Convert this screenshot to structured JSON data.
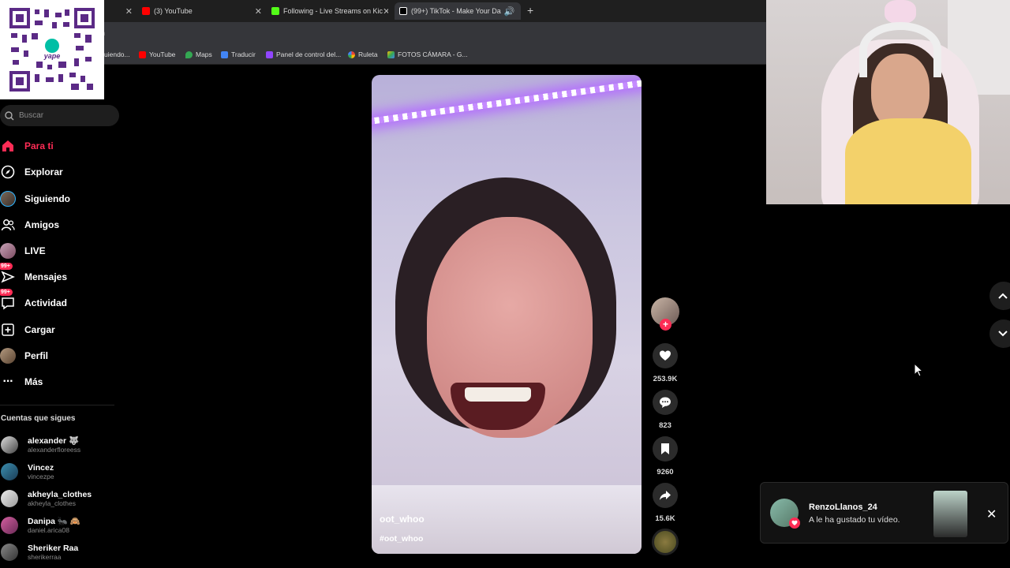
{
  "browser": {
    "tabs": [
      {
        "label": "",
        "icon": "blank-tab-icon"
      },
      {
        "label": "(3) YouTube",
        "icon": "youtube-icon",
        "color": "#ff0000"
      },
      {
        "label": "Following - Live Streams on Kic",
        "icon": "kick-icon",
        "color": "#53fc18"
      },
      {
        "label": "(99+) TikTok - Make Your Da",
        "icon": "tiktok-icon",
        "color": "#ffffff"
      }
    ],
    "address_fragment": "n",
    "bookmarks": [
      {
        "label": "uiendo...",
        "icon": "bookmark-icon"
      },
      {
        "label": "YouTube",
        "icon": "youtube-icon"
      },
      {
        "label": "Maps",
        "icon": "maps-icon"
      },
      {
        "label": "Traducir",
        "icon": "translate-icon"
      },
      {
        "label": "Panel de control del...",
        "icon": "twitch-icon"
      },
      {
        "label": "Ruleta",
        "icon": "wheel-icon"
      },
      {
        "label": "FOTOS CÁMARA - G...",
        "icon": "drive-icon"
      }
    ]
  },
  "qr": {
    "brand": "yape"
  },
  "sidebar": {
    "search_placeholder": "Buscar",
    "nav": [
      {
        "label": "Para ti",
        "icon": "home-icon",
        "active": true
      },
      {
        "label": "Explorar",
        "icon": "compass-icon"
      },
      {
        "label": "Siguiendo",
        "icon": "following-avatar-icon"
      },
      {
        "label": "Amigos",
        "icon": "friends-icon"
      },
      {
        "label": "LIVE",
        "icon": "live-avatar-icon"
      },
      {
        "label": "Mensajes",
        "icon": "message-icon",
        "badge": "99+"
      },
      {
        "label": "Actividad",
        "icon": "activity-icon",
        "badge": "99+"
      },
      {
        "label": "Cargar",
        "icon": "upload-icon"
      },
      {
        "label": "Perfil",
        "icon": "profile-avatar-icon"
      },
      {
        "label": "Más",
        "icon": "more-icon"
      }
    ],
    "following_title": "Cuentas que sigues",
    "accounts": [
      {
        "name": "alexander 🐺",
        "handle": "alexanderfloreess"
      },
      {
        "name": "Vincez",
        "handle": "vincezpe"
      },
      {
        "name": "akheyla_clothes",
        "handle": "akheyla_clothes"
      },
      {
        "name": "Danipa 🐜 🙈",
        "handle": "daniel.arica08"
      },
      {
        "name": "Sheriker Raa",
        "handle": "sherikerraa"
      }
    ]
  },
  "video": {
    "username": "oot_whoo",
    "hashtag": "#oot_whoo"
  },
  "actions": {
    "likes": "253.9K",
    "comments": "823",
    "saves": "9260",
    "shares": "15.6K"
  },
  "notification": {
    "user": "RenzoLlanos_24",
    "message": "A le ha gustado tu vídeo."
  },
  "colors": {
    "accent": "#fe2c55"
  }
}
